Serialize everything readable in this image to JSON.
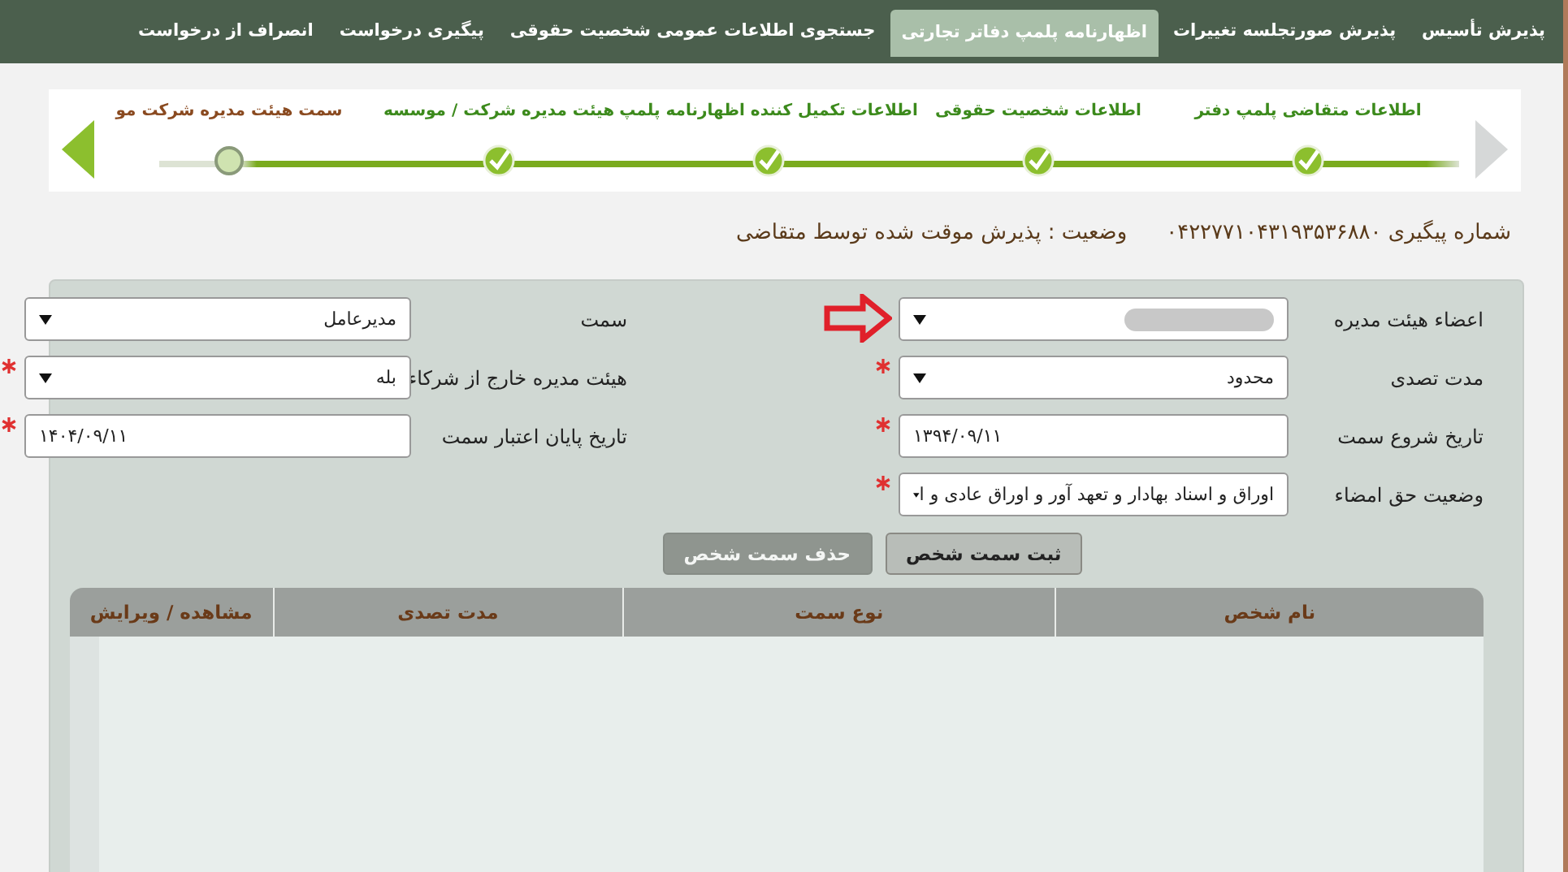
{
  "nav_tabs": [
    {
      "label": "پذیرش تأسیس",
      "selected": false
    },
    {
      "label": "پذیرش صورتجلسه تغییرات",
      "selected": false
    },
    {
      "label": "اظهارنامه پلمپ دفاتر تجارتی",
      "selected": true
    },
    {
      "label": "جستجوی اطلاعات عمومی شخصیت حقوقی",
      "selected": false
    },
    {
      "label": "پیگیری درخواست",
      "selected": false
    },
    {
      "label": "انصراف از درخواست",
      "selected": false
    }
  ],
  "steps": [
    {
      "label": "اطلاعات متقاضی پلمپ دفتر",
      "completed": true
    },
    {
      "label": "اطلاعات شخصیت حقوقی",
      "completed": true
    },
    {
      "label": "اطلاعات تکمیل کننده اظهارنامه پلمپ",
      "completed": true
    },
    {
      "label": "هیئت مدیره شرکت / موسسه",
      "completed": true
    },
    {
      "label": "سمت هیئت مدیره شرکت مو",
      "completed": false
    }
  ],
  "tracking": {
    "number": "شماره پیگیری ۰۴۲۲۷۷۱۰۴۳۱۹۳۵۳۶۸۸۰",
    "status": "وضعیت : پذیرش موقت شده توسط متقاضی"
  },
  "fields": [
    {
      "label": "اعضاء هیئت مدیره",
      "kind": "select",
      "redacted": true,
      "required": false,
      "highlighted": true
    },
    {
      "label": "سمت",
      "kind": "select",
      "value": "مدیرعامل",
      "required": false,
      "highlighted": false
    },
    {
      "label": "مدت تصدی",
      "kind": "select",
      "value": "محدود",
      "required": true,
      "highlighted": false
    },
    {
      "label": "هیئت مدیره خارج از شرکاء",
      "kind": "select",
      "value": "بله",
      "required": true,
      "highlighted": false
    },
    {
      "label": "تاریخ شروع سمت",
      "kind": "text",
      "value": "۱۳۹۴/۰۹/۱۱",
      "required": true,
      "highlighted": false
    },
    {
      "label": "تاریخ پایان اعتبار سمت",
      "kind": "text",
      "value": "۱۴۰۴/۰۹/۱۱",
      "required": true,
      "highlighted": false
    },
    {
      "label": "وضعیت حق امضاء",
      "kind": "select",
      "value": "اوراق و اسناد بهادار و تعهد آور و اوراق عادی و ا",
      "required": true,
      "highlighted": false
    }
  ],
  "buttons": [
    {
      "label": "ثبت سمت شخص",
      "disabled": false
    },
    {
      "label": "حذف سمت شخص",
      "disabled": true
    }
  ],
  "table": {
    "columns": [
      "نام شخص",
      "نوع سمت",
      "مدت تصدی",
      "مشاهده / ویرایش"
    ]
  }
}
